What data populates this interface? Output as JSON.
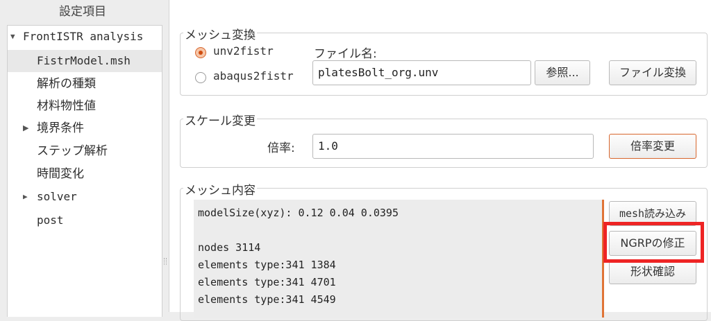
{
  "tree": {
    "header": "設定項目",
    "items": [
      {
        "label": "FrontISTR analysis",
        "arrow": "▼"
      },
      {
        "label": "FistrModel.msh"
      },
      {
        "label": "解析の種類"
      },
      {
        "label": "材料物性値"
      },
      {
        "label": "境界条件",
        "arrow": "▶"
      },
      {
        "label": "ステップ解析"
      },
      {
        "label": "時間変化"
      },
      {
        "label": "solver",
        "arrow": "▶"
      },
      {
        "label": "post"
      }
    ]
  },
  "mesh_convert": {
    "title": "メッシュ変換",
    "options": [
      "unv2fistr",
      "abaqus2fistr"
    ],
    "selected": "unv2fistr",
    "file_label": "ファイル名:",
    "file_value": "platesBolt_org.unv",
    "browse_label": "参照...",
    "convert_label": "ファイル変換"
  },
  "scale": {
    "title": "スケール変更",
    "ratio_label": "倍率:",
    "ratio_value": "1.0",
    "apply_label": "倍率変更"
  },
  "mesh_content": {
    "title": "メッシュ内容",
    "lines": [
      "modelSize(xyz): 0.12 0.04 0.0395",
      "",
      "nodes 3114",
      "elements type:341 1384",
      "elements type:341 4701",
      "elements type:341 4549"
    ],
    "buttons": {
      "read_mesh": "mesh読み込み",
      "fix_ngrp": "NGRPの修正",
      "check_shape": "形状確認"
    }
  },
  "colors": {
    "accent": "#e07436",
    "highlight": "#ee2424"
  }
}
